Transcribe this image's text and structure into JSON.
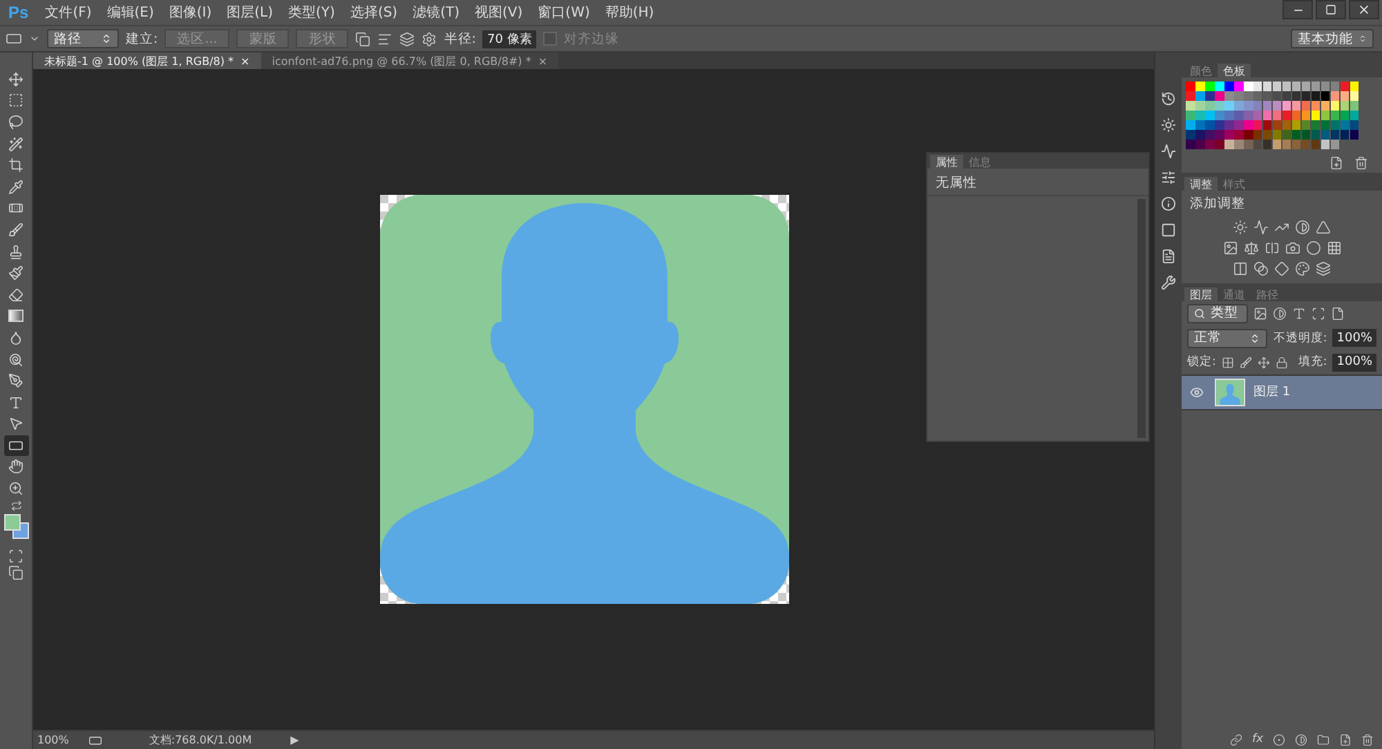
{
  "app_logo": "Ps",
  "menu": [
    "文件(F)",
    "编辑(E)",
    "图像(I)",
    "图层(L)",
    "类型(Y)",
    "选择(S)",
    "滤镜(T)",
    "视图(V)",
    "窗口(W)",
    "帮助(H)"
  ],
  "options_bar": {
    "mode": "路径",
    "make_label": "建立:",
    "make_buttons": [
      "选区...",
      "蒙版",
      "形状"
    ],
    "radius_label": "半径:",
    "radius_value": "70 像素",
    "align_edges": {
      "label": "对齐边缘",
      "checked": false
    },
    "workspace": "基本功能"
  },
  "document_tabs": [
    {
      "title": "未标题-1 @ 100% (图层 1, RGB/8) *",
      "close": "×",
      "selected": true
    },
    {
      "title": "iconfont-ad76.png @ 66.7% (图层 0, RGB/8#) *",
      "close": "×",
      "selected": false
    }
  ],
  "tools": [
    {
      "kind": "move",
      "selected": false
    },
    {
      "kind": "marquee",
      "selected": false
    },
    {
      "kind": "lasso",
      "selected": false
    },
    {
      "kind": "wand",
      "selected": false
    },
    {
      "kind": "crop",
      "selected": false
    },
    {
      "kind": "eyedropper",
      "selected": false
    },
    {
      "kind": "healing",
      "selected": false
    },
    {
      "kind": "brush",
      "selected": false
    },
    {
      "kind": "stamp",
      "selected": false
    },
    {
      "kind": "history",
      "selected": false
    },
    {
      "kind": "eraser",
      "selected": false
    },
    {
      "kind": "gradient",
      "selected": false
    },
    {
      "kind": "blur",
      "selected": false
    },
    {
      "kind": "dodge",
      "selected": false
    },
    {
      "kind": "pen",
      "selected": false
    },
    {
      "kind": "type",
      "selected": false
    },
    {
      "kind": "path",
      "selected": false
    },
    {
      "kind": "shape",
      "selected": true
    },
    {
      "kind": "hand",
      "selected": false
    },
    {
      "kind": "zoom",
      "selected": false
    }
  ],
  "tool_colors": [
    {
      "color": "#8ccb98"
    },
    {
      "color": "#6da3e3"
    }
  ],
  "properties_panel": {
    "tabs": [
      {
        "label": "属性",
        "selected": true
      },
      {
        "label": "信息",
        "selected": false
      }
    ],
    "message": "无属性"
  },
  "status_bar": {
    "zoom": "100%",
    "doc_info": "文档:768.0K/1.00M",
    "arrow": "▶"
  },
  "swatches_panel": {
    "tabs": [
      {
        "label": "颜色",
        "selected": false
      },
      {
        "label": "色板",
        "selected": true
      }
    ],
    "swatches": [
      {
        "color": "#ff0000"
      },
      {
        "color": "#ffff00"
      },
      {
        "color": "#00ff00"
      },
      {
        "color": "#00ffff"
      },
      {
        "color": "#0000ff"
      },
      {
        "color": "#ff00ff"
      },
      {
        "color": "#ffffff"
      },
      {
        "color": "#e6e6e6"
      },
      {
        "color": "#d9d9d9"
      },
      {
        "color": "#cccccc"
      },
      {
        "color": "#bfbfbf"
      },
      {
        "color": "#b3b3b3"
      },
      {
        "color": "#a6a6a6"
      },
      {
        "color": "#999999"
      },
      {
        "color": "#8c8c8c"
      },
      {
        "color": "#808080"
      },
      {
        "color": "#ed1c24"
      },
      {
        "color": "#fff200"
      },
      {
        "color": "#ed1c24"
      },
      {
        "color": "#00a2e8"
      },
      {
        "color": "#2e3192"
      },
      {
        "color": "#ec008c"
      },
      {
        "color": "#8c8c8c"
      },
      {
        "color": "#808080"
      },
      {
        "color": "#737373"
      },
      {
        "color": "#666666"
      },
      {
        "color": "#595959"
      },
      {
        "color": "#4d4d4d"
      },
      {
        "color": "#404040"
      },
      {
        "color": "#333333"
      },
      {
        "color": "#262626"
      },
      {
        "color": "#1a1a1a"
      },
      {
        "color": "#000000"
      },
      {
        "color": "#f7977a"
      },
      {
        "color": "#fbad82"
      },
      {
        "color": "#fff799"
      },
      {
        "color": "#c4df9b"
      },
      {
        "color": "#a3d39c"
      },
      {
        "color": "#82ca9c"
      },
      {
        "color": "#7accc8"
      },
      {
        "color": "#6dcff6"
      },
      {
        "color": "#7da7d9"
      },
      {
        "color": "#8393ca"
      },
      {
        "color": "#8781bd"
      },
      {
        "color": "#a187be"
      },
      {
        "color": "#bc8dbf"
      },
      {
        "color": "#f49ac2"
      },
      {
        "color": "#f6989d"
      },
      {
        "color": "#f26c4f"
      },
      {
        "color": "#f68e56"
      },
      {
        "color": "#fbaf5d"
      },
      {
        "color": "#fff568"
      },
      {
        "color": "#acd373"
      },
      {
        "color": "#7cc576"
      },
      {
        "color": "#3bb878"
      },
      {
        "color": "#1abbb4"
      },
      {
        "color": "#00bff3"
      },
      {
        "color": "#438ccb"
      },
      {
        "color": "#5574b9"
      },
      {
        "color": "#605ca8"
      },
      {
        "color": "#855fa8"
      },
      {
        "color": "#a863a8"
      },
      {
        "color": "#f06eaa"
      },
      {
        "color": "#f26d7d"
      },
      {
        "color": "#ed1c25"
      },
      {
        "color": "#f26522"
      },
      {
        "color": "#f7941d"
      },
      {
        "color": "#fff201"
      },
      {
        "color": "#8dc63f"
      },
      {
        "color": "#39b54a"
      },
      {
        "color": "#00a651"
      },
      {
        "color": "#00a99d"
      },
      {
        "color": "#00aeef"
      },
      {
        "color": "#0072bc"
      },
      {
        "color": "#0054a6"
      },
      {
        "color": "#2e3193"
      },
      {
        "color": "#662d91"
      },
      {
        "color": "#92278f"
      },
      {
        "color": "#ec008d"
      },
      {
        "color": "#ed145b"
      },
      {
        "color": "#9e0b0f"
      },
      {
        "color": "#a0410d"
      },
      {
        "color": "#a36209"
      },
      {
        "color": "#aba000"
      },
      {
        "color": "#598527"
      },
      {
        "color": "#197b30"
      },
      {
        "color": "#007236"
      },
      {
        "color": "#00746b"
      },
      {
        "color": "#0076a3"
      },
      {
        "color": "#004a80"
      },
      {
        "color": "#003471"
      },
      {
        "color": "#1b1464"
      },
      {
        "color": "#440e62"
      },
      {
        "color": "#630460"
      },
      {
        "color": "#9e005d"
      },
      {
        "color": "#9e0039"
      },
      {
        "color": "#790000"
      },
      {
        "color": "#7b2e00"
      },
      {
        "color": "#7d4900"
      },
      {
        "color": "#827b00"
      },
      {
        "color": "#406618"
      },
      {
        "color": "#005e20"
      },
      {
        "color": "#005826"
      },
      {
        "color": "#005952"
      },
      {
        "color": "#005b7f"
      },
      {
        "color": "#003663"
      },
      {
        "color": "#002157"
      },
      {
        "color": "#0d004c"
      },
      {
        "color": "#32004b"
      },
      {
        "color": "#4b0049"
      },
      {
        "color": "#7b0046"
      },
      {
        "color": "#7a0026"
      },
      {
        "color": "#c7b299"
      },
      {
        "color": "#998675"
      },
      {
        "color": "#736357"
      },
      {
        "color": "#534741"
      },
      {
        "color": "#37302a"
      },
      {
        "color": "#c69c6d"
      },
      {
        "color": "#a67c52"
      },
      {
        "color": "#8c6239"
      },
      {
        "color": "#754c24"
      },
      {
        "color": "#603913"
      },
      {
        "color": "#c2c2c2"
      },
      {
        "color": "#959595"
      }
    ]
  },
  "adjustments_panel": {
    "tabs": [
      {
        "label": "调整",
        "selected": true
      },
      {
        "label": "样式",
        "selected": false
      }
    ],
    "heading": "添加调整"
  },
  "layers_panel": {
    "tabs": [
      {
        "label": "图层",
        "selected": true
      },
      {
        "label": "通道",
        "selected": false
      },
      {
        "label": "路径",
        "selected": false
      }
    ],
    "filter_type": "类型",
    "blend_mode": "正常",
    "opacity_label": "不透明度:",
    "opacity": "100%",
    "lock_label": "锁定:",
    "fill_label": "填充:",
    "fill": "100%",
    "layers": [
      {
        "name": "图层 1",
        "visible": true,
        "selected": true
      }
    ],
    "footer_fx": "fx"
  }
}
